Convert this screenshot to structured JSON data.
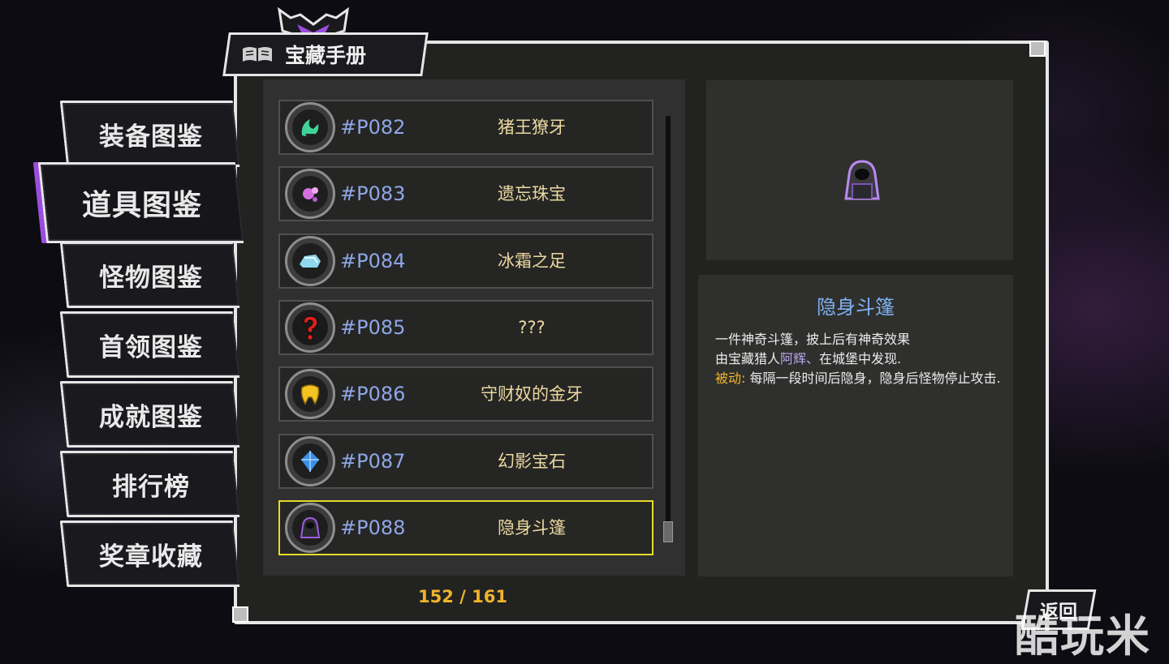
{
  "window": {
    "title": "宝藏手册"
  },
  "menu": {
    "items": [
      {
        "label": "装备图鉴",
        "active": false
      },
      {
        "label": "道具图鉴",
        "active": true
      },
      {
        "label": "怪物图鉴",
        "active": false
      },
      {
        "label": "首领图鉴",
        "active": false
      },
      {
        "label": "成就图鉴",
        "active": false
      },
      {
        "label": "排行榜",
        "active": false
      },
      {
        "label": "奖章收藏",
        "active": false
      }
    ]
  },
  "list": {
    "items": [
      {
        "code": "#P082",
        "name": "猪王獠牙",
        "icon": "boar-tusk-icon",
        "color": "#3fd39a"
      },
      {
        "code": "#P083",
        "name": "遗忘珠宝",
        "icon": "jewel-icon",
        "color": "#d36fe0"
      },
      {
        "code": "#P084",
        "name": "冰霜之足",
        "icon": "frost-foot-icon",
        "color": "#8fd6f0"
      },
      {
        "code": "#P085",
        "name": "???",
        "icon": "question-mark-icon",
        "color": "#e01e1e"
      },
      {
        "code": "#P086",
        "name": "守财奴的金牙",
        "icon": "gold-tooth-icon",
        "color": "#f3c321"
      },
      {
        "code": "#P087",
        "name": "幻影宝石",
        "icon": "phantom-gem-icon",
        "color": "#3c8fe8"
      },
      {
        "code": "#P088",
        "name": "隐身斗篷",
        "icon": "cloak-icon",
        "color": "#9a5de0"
      }
    ],
    "selected_index": 6,
    "count": "152 / 161"
  },
  "detail": {
    "name": "隐身斗篷",
    "line1": "一件神奇斗篷，披上后有神奇效果",
    "line2_prefix": "由宝藏猎人",
    "line2_hunter": "阿辉、",
    "line2_suffix": "在城堡中发现.",
    "passive_label": "被动:",
    "passive_text": " 每隔一段时间后隐身，隐身后怪物停止攻击."
  },
  "back_button": {
    "label": "返回"
  },
  "watermark": "酷玩米"
}
